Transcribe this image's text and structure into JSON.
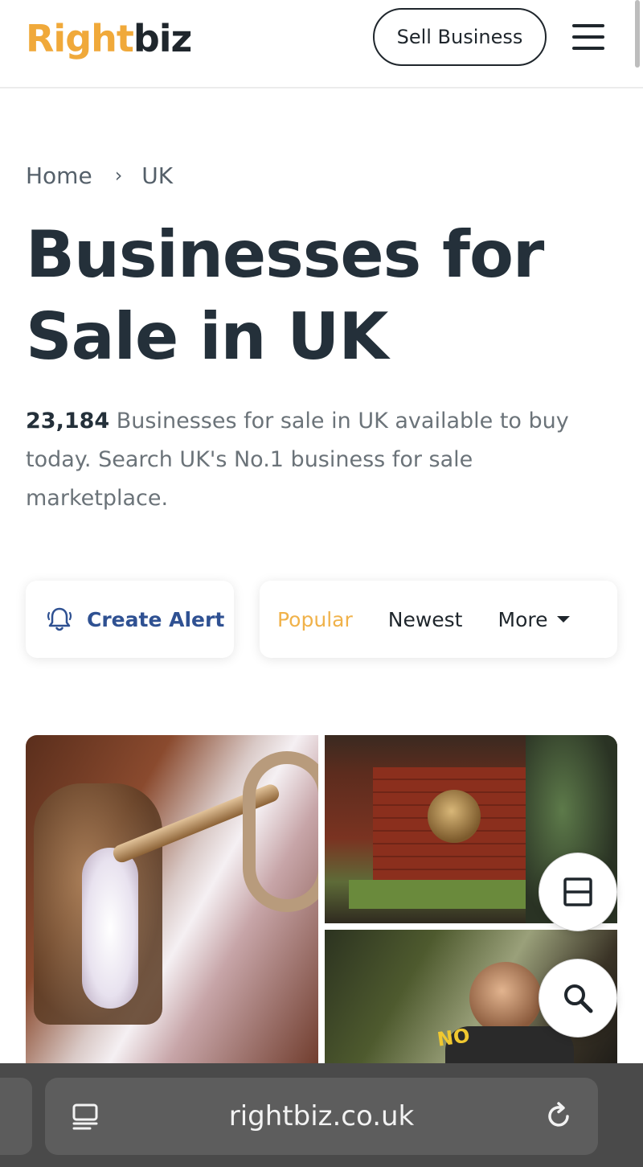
{
  "header": {
    "logo_part1": "Right",
    "logo_part2": "biz",
    "sell_button": "Sell Business",
    "menu_icon": "hamburger-menu-icon"
  },
  "breadcrumb": {
    "home": "Home",
    "separator": "›",
    "current": "UK"
  },
  "page": {
    "title": "Businesses for Sale in UK",
    "count": "23,184",
    "description": " Businesses for sale in UK available to buy today. Search UK's No.1 business for sale marketplace."
  },
  "controls": {
    "create_alert": "Create Alert",
    "alert_icon": "bell-icon",
    "sort_tabs": [
      "Popular",
      "Newest",
      "More"
    ],
    "active_sort": "Popular"
  },
  "gallery": {
    "sign_text": "NO"
  },
  "fabs": {
    "layout_icon": "layout-toggle-icon",
    "search_icon": "search-icon"
  },
  "browser": {
    "url": "rightbiz.co.uk",
    "reader_icon": "reader-mode-icon",
    "reload_icon": "reload-icon"
  },
  "colors": {
    "brand_orange": "#f0a93a",
    "brand_dark": "#1f262c",
    "alert_blue": "#2f5192",
    "active_sort": "#f0b24a"
  }
}
